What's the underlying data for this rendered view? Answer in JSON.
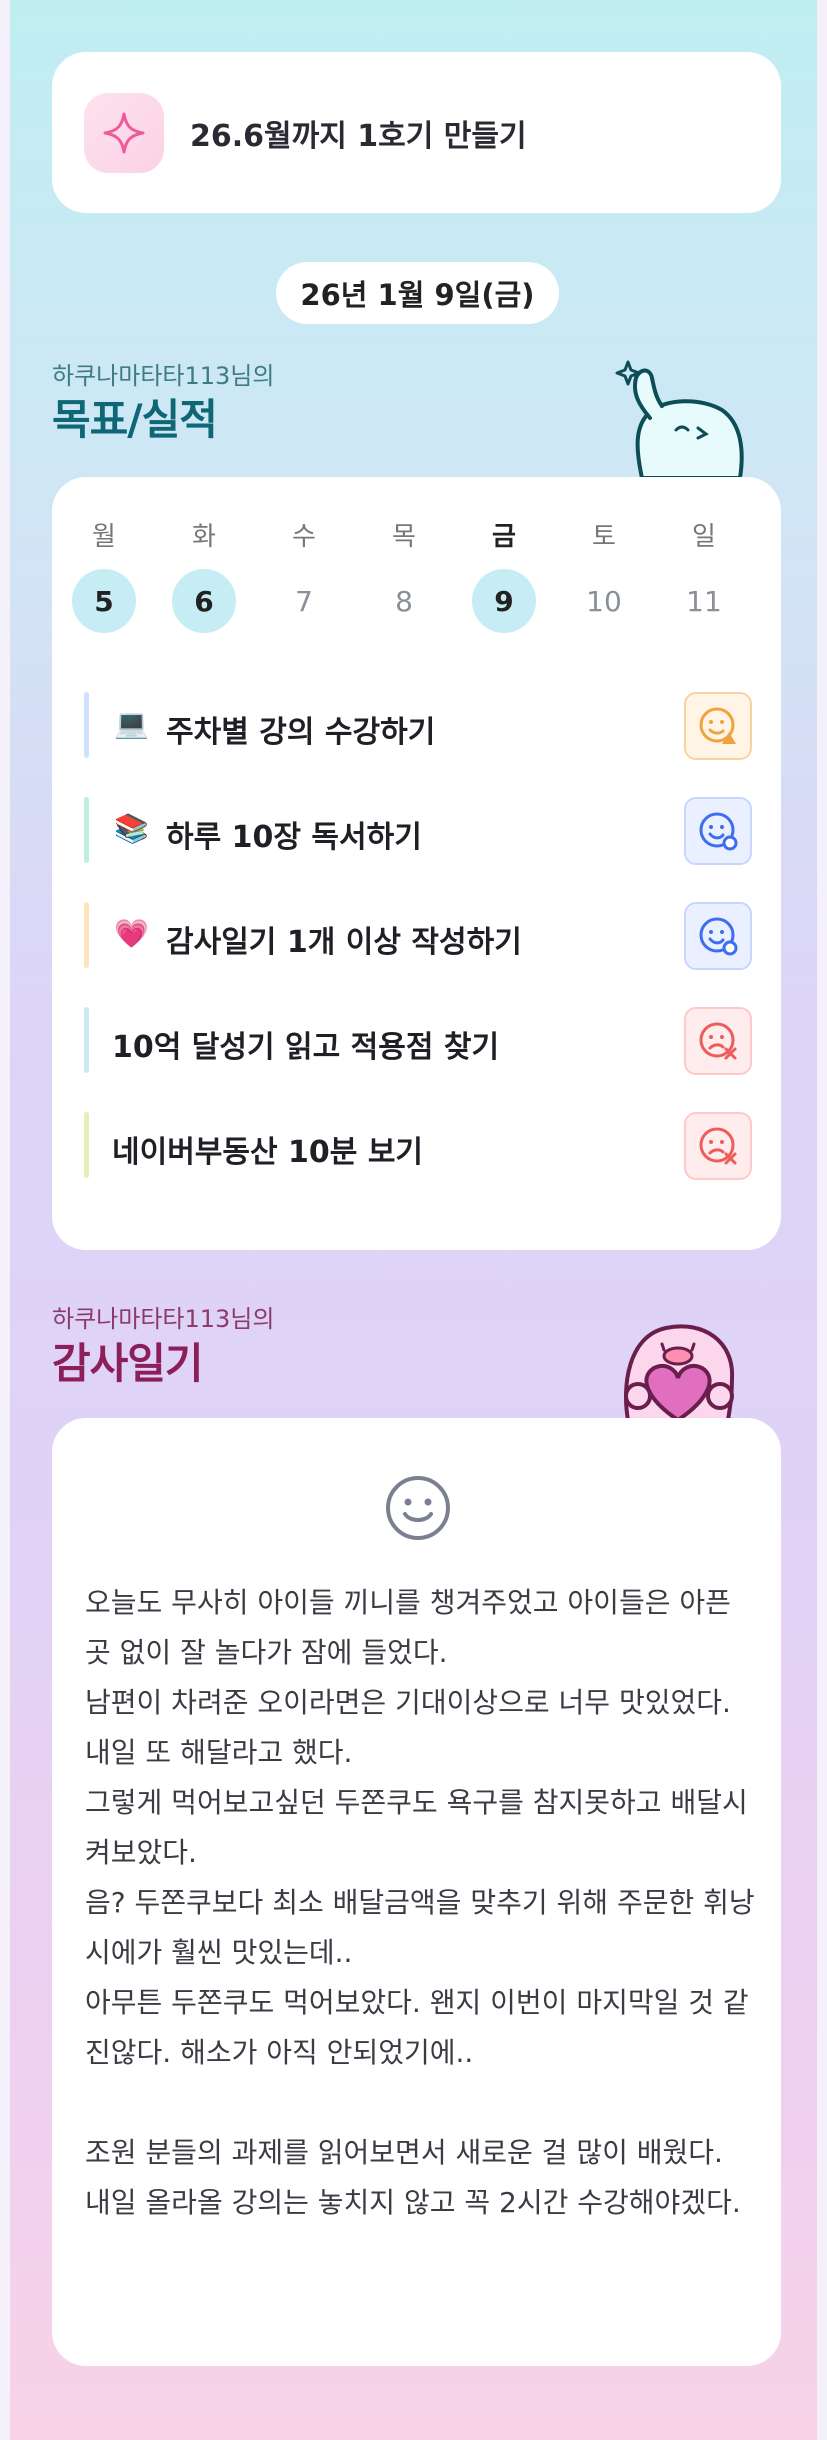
{
  "goal_banner": {
    "icon": "sparkle-icon",
    "text": "26.6월까지 1호기 만들기"
  },
  "date_label": "26년 1월 9일(금)",
  "goals_section": {
    "subtitle": "하쿠나마타타113님의",
    "title": "목표/실적"
  },
  "week": [
    {
      "name": "월",
      "day": "5",
      "active": true,
      "today": false
    },
    {
      "name": "화",
      "day": "6",
      "active": true,
      "today": false
    },
    {
      "name": "수",
      "day": "7",
      "active": false,
      "today": false
    },
    {
      "name": "목",
      "day": "8",
      "active": false,
      "today": false
    },
    {
      "name": "금",
      "day": "9",
      "active": true,
      "today": true
    },
    {
      "name": "토",
      "day": "10",
      "active": false,
      "today": false
    },
    {
      "name": "일",
      "day": "11",
      "active": false,
      "today": false
    }
  ],
  "goals": [
    {
      "emoji": "💻",
      "label": "주차별 강의 수강하기",
      "bar_color": "#cfe0ff",
      "status": "warning",
      "status_icon": "smile-warning-icon"
    },
    {
      "emoji": "📚",
      "label": "하루 10장 독서하기",
      "bar_color": "#bfeedd",
      "status": "done",
      "status_icon": "smile-check-icon"
    },
    {
      "emoji": "💗",
      "label": "감사일기 1개 이상 작성하기",
      "bar_color": "#fde4bd",
      "status": "done",
      "status_icon": "smile-check-icon"
    },
    {
      "emoji": "",
      "label": "10억 달성기 읽고 적용점 찾기",
      "bar_color": "#c9ecf3",
      "status": "failed",
      "status_icon": "sad-x-icon"
    },
    {
      "emoji": "",
      "label": "네이버부동산 10분 보기",
      "bar_color": "#e3f0b8",
      "status": "failed",
      "status_icon": "sad-x-icon"
    }
  ],
  "diary_section": {
    "subtitle": "하쿠나마타타113님의",
    "title": "감사일기"
  },
  "diary": {
    "mood_icon": "smile-face-icon",
    "text": "오늘도 무사히 아이들 끼니를 챙겨주었고 아이들은 아픈 곳 없이 잘 놀다가 잠에 들었다.\n남편이 차려준 오이라면은 기대이상으로 너무 맛있었다. 내일 또 해달라고 했다.\n그렇게 먹어보고싶던 두쫀쿠도 욕구를 참지못하고 배달시켜보았다.\n음? 두쫀쿠보다 최소 배달금액을 맞추기 위해 주문한 휘낭시에가 훨씬 맛있는데..\n아무튼 두쫀쿠도 먹어보았다. 왠지 이번이 마지막일 것 같진않다. 해소가 아직 안되었기에..\n\n조원 분들의 과제를 읽어보면서 새로운 걸 많이 배웠다.\n내일 올라올 강의는 놓치지 않고 꼭 2시간 수강해야겠다."
  },
  "colors": {
    "accent_teal": "#0f6675",
    "accent_plum": "#8c1f5a",
    "active_day": "#c6edf4"
  }
}
